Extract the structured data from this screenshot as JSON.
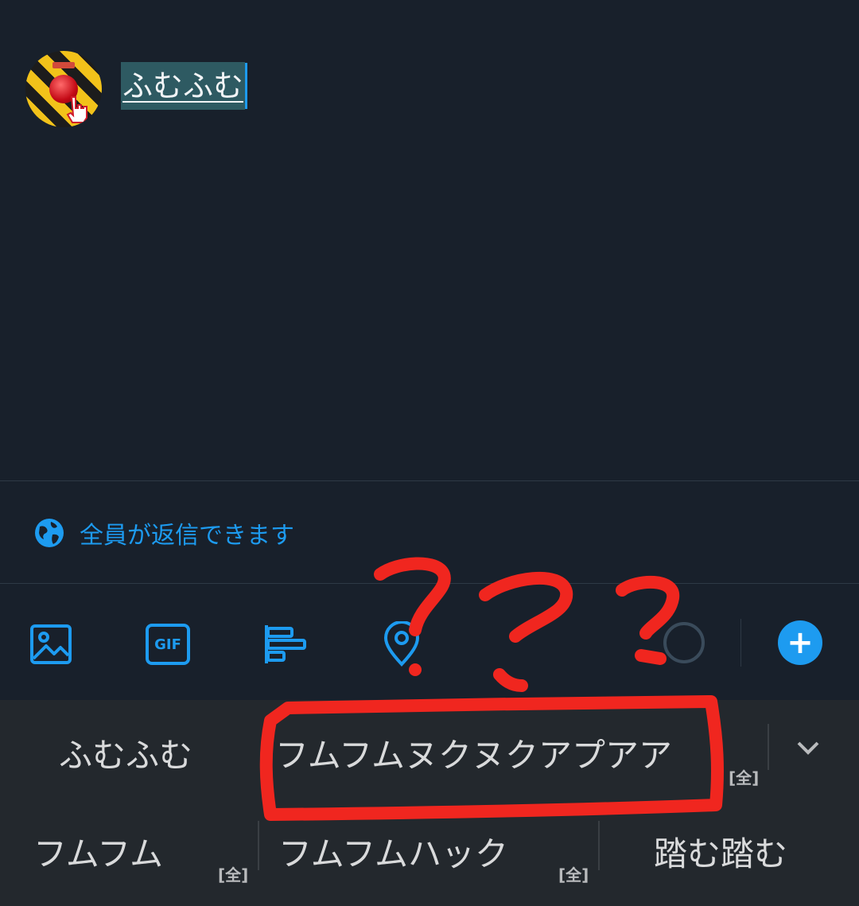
{
  "compose": {
    "text": "ふむふむ"
  },
  "reply_setting": {
    "label": "全員が返信できます"
  },
  "toolbar": {
    "icons": [
      "image-icon",
      "gif-icon",
      "poll-icon",
      "location-icon"
    ],
    "gif_text": "GIF",
    "add_label": "+"
  },
  "suggestions": {
    "row1": [
      "ふむふむ",
      "フムフムヌクヌクアプアア"
    ],
    "row2": [
      "フムフム",
      "フムフムハック",
      "踏む踏む"
    ],
    "tag": "[全]"
  },
  "annotation": {
    "marks": "? ? ?",
    "color": "#f0261f"
  },
  "colors": {
    "accent": "#1d9bf0",
    "background": "#18202b",
    "keyboard": "#23282d"
  }
}
